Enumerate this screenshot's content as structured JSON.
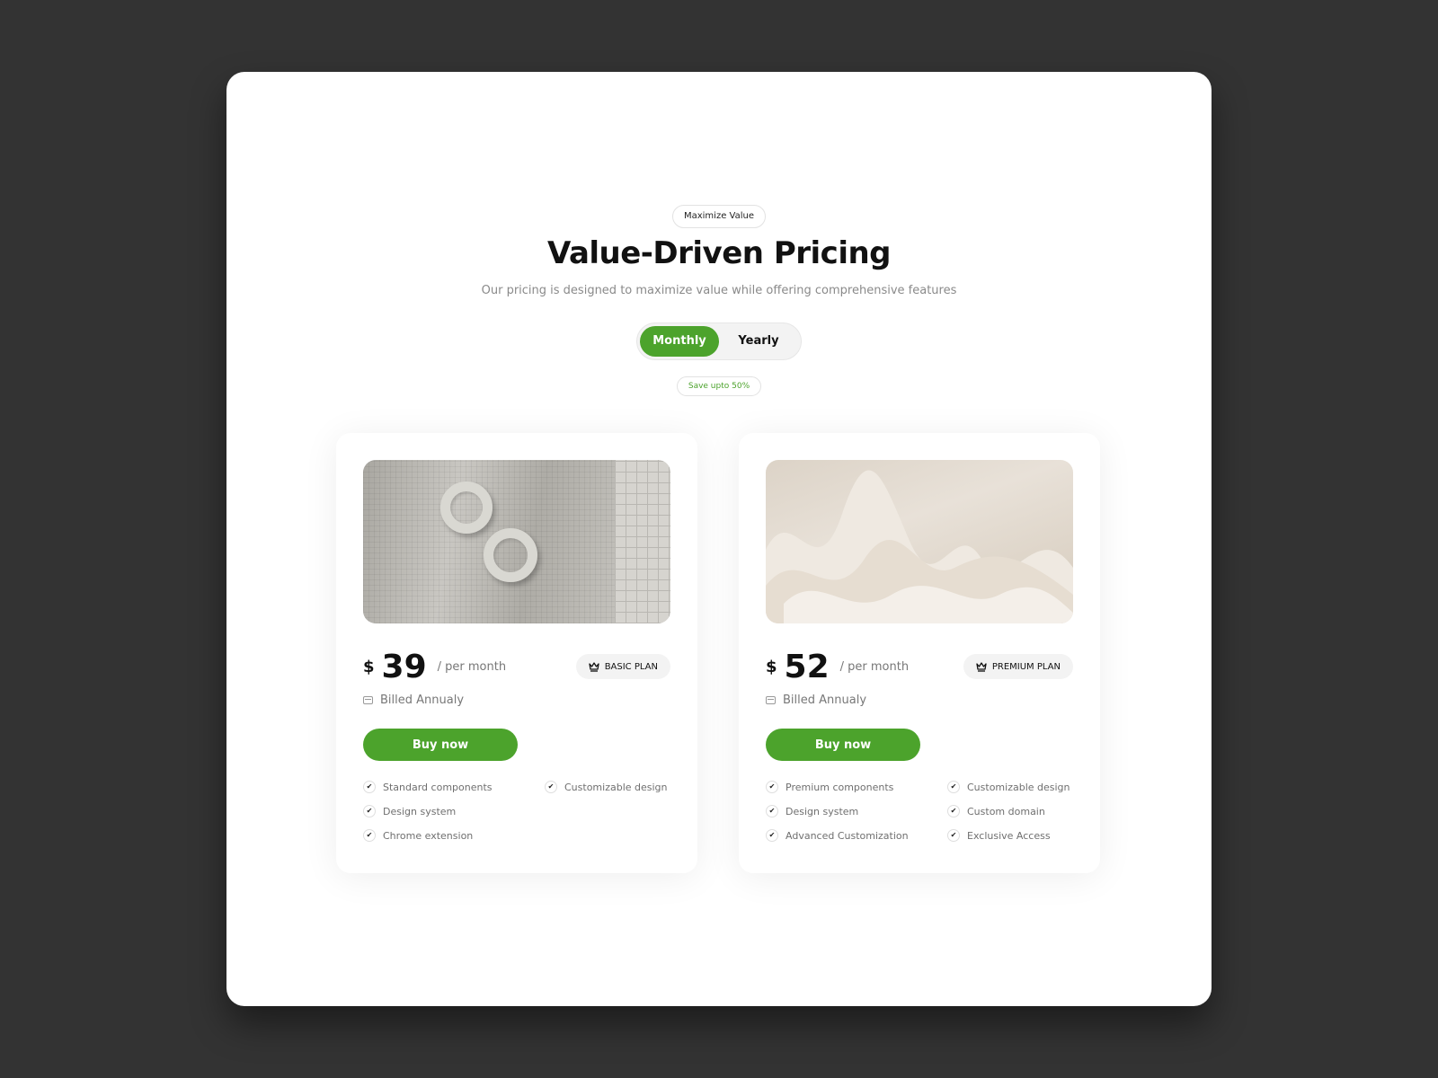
{
  "header": {
    "eyebrow": "Maximize Value",
    "title": "Value-Driven Pricing",
    "subtitle": "Our pricing is designed to maximize value while offering comprehensive features"
  },
  "billing_toggle": {
    "options": [
      "Monthly",
      "Yearly"
    ],
    "selected": "Monthly"
  },
  "save_badge": "Save upto 50%",
  "colors": {
    "accent": "#4ca32c",
    "background": "#333333",
    "card": "#ffffff"
  },
  "plans": [
    {
      "currency": "$",
      "price": "39",
      "period": "/ per month",
      "badge": "BASIC PLAN",
      "badge_icon": "crown-icon",
      "billed": "Billed Annualy",
      "cta": "Buy now",
      "features": [
        "Standard components",
        "Customizable design",
        "Design system",
        "Chrome extension"
      ]
    },
    {
      "currency": "$",
      "price": "52",
      "period": "/ per month",
      "badge": "PREMIUM PLAN",
      "badge_icon": "crown-icon",
      "billed": "Billed Annualy",
      "cta": "Buy now",
      "features": [
        "Premium components",
        "Customizable design",
        "Design system",
        "Custom domain",
        "Advanced Customization",
        "Exclusive Access"
      ]
    }
  ]
}
